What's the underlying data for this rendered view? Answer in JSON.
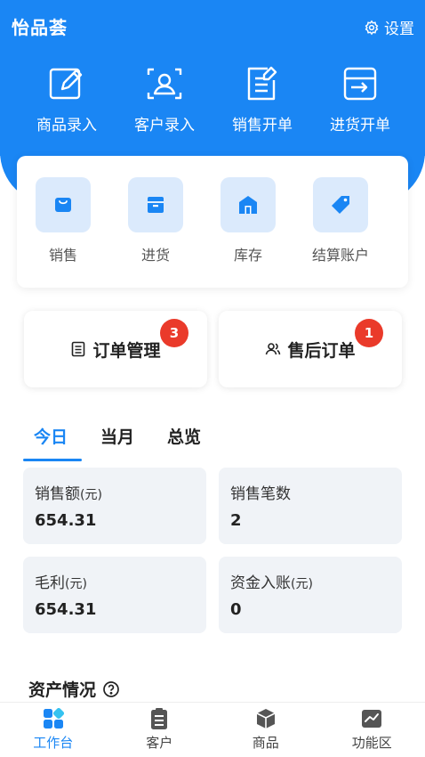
{
  "header": {
    "brand": "怡品荟",
    "settings_label": "设置"
  },
  "quick_actions": [
    {
      "label": "商品录入",
      "icon": "edit-icon"
    },
    {
      "label": "客户录入",
      "icon": "user-card-icon"
    },
    {
      "label": "销售开单",
      "icon": "doc-write-icon"
    },
    {
      "label": "进货开单",
      "icon": "inbox-arrow-icon"
    }
  ],
  "panel": [
    {
      "label": "销售",
      "icon": "bag-icon"
    },
    {
      "label": "进货",
      "icon": "box-icon"
    },
    {
      "label": "库存",
      "icon": "warehouse-icon"
    },
    {
      "label": "结算账户",
      "icon": "tag-icon"
    }
  ],
  "orders": [
    {
      "label": "订单管理",
      "badge": "3",
      "icon": "list-icon"
    },
    {
      "label": "售后订单",
      "badge": "1",
      "icon": "users-icon"
    }
  ],
  "tabs": [
    "今日",
    "当月",
    "总览"
  ],
  "stats": [
    {
      "label": "销售额",
      "unit": "(元)",
      "value": "654.31"
    },
    {
      "label": "销售笔数",
      "unit": "",
      "value": "2"
    },
    {
      "label": "毛利",
      "unit": "(元)",
      "value": "654.31"
    },
    {
      "label": "资金入账",
      "unit": "(元)",
      "value": "0"
    }
  ],
  "assets_title": "资产情况",
  "nav": [
    "工作台",
    "客户",
    "商品",
    "功能区"
  ],
  "colors": {
    "primary": "#1a86f4",
    "badge": "#ea3a2a",
    "card_bg": "#f0f3f7",
    "icon_bg": "#dbeafc"
  }
}
